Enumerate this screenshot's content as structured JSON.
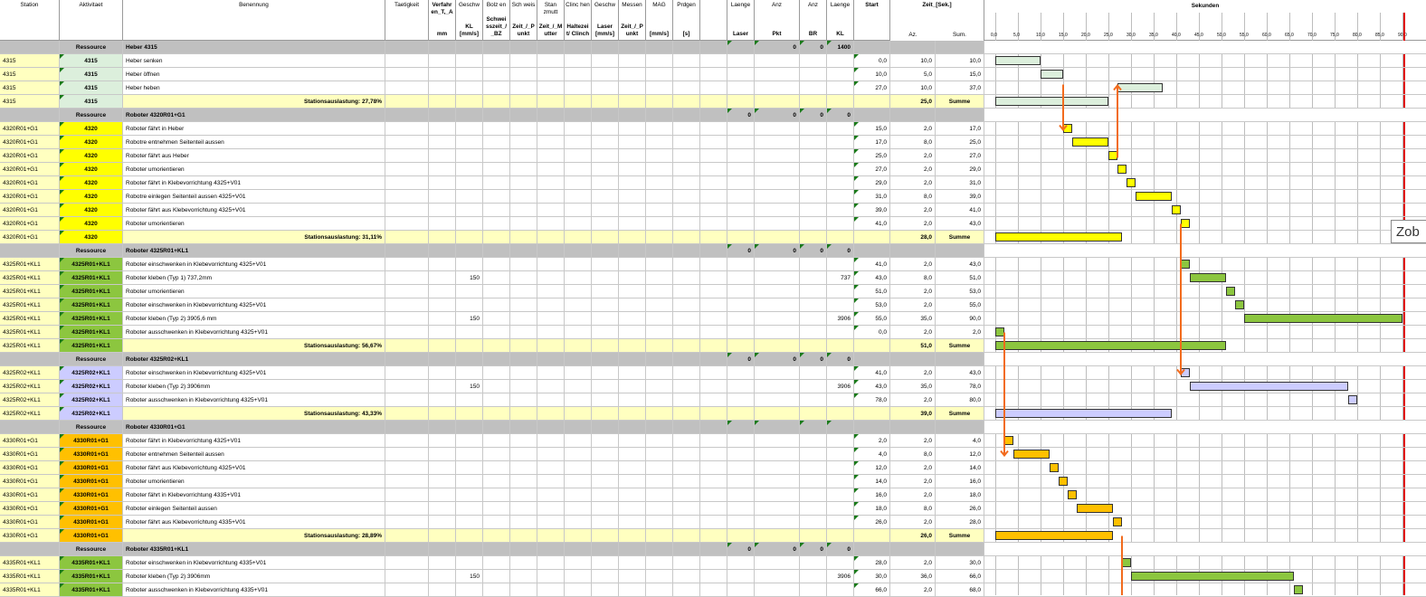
{
  "header": {
    "station": "Station",
    "aktivitaet": "Aktivitaet",
    "benennung": "Benennung",
    "taetigkeit": "Taetigkeit",
    "verfahren_top": "Verfahr en_T,_A",
    "verfahren_bot": "mm",
    "geschw1_top": "Geschw",
    "geschw1_bot": "KL [mm/s]",
    "bolzen_top": "Bolz en",
    "bolzen_bot": "Schwei sszeit_/ _BZ",
    "schweiss_top": "Sch weis",
    "schweiss_bot": "Zeit_/_P unkt",
    "stanz_top": "Stan zmutt",
    "stanz_bot": "Zeit_/_M utter",
    "clinch_top": "Clinc hen",
    "clinch_bot": "Haltezei t/ Clinch",
    "geschw2_top": "Geschw",
    "geschw2_bot": "Laser [mm/s]",
    "messen_top": "Messen",
    "messen_bot": "Zeit_/_P unkt",
    "mag_top": "MAG",
    "mag_bot": "[mm/s]",
    "pruefgen_top": "Prdgen",
    "pruefgen_bot": "[s]",
    "laenge1_top": "Laenge",
    "laenge1_bot": "Laser",
    "anz_pkt_top": "Anz",
    "anz_pkt_bot": "Pkt",
    "anz_br_top": "Anz",
    "anz_br_bot": "BR",
    "laenge2_top": "Laenge",
    "laenge2_bot": "KL",
    "start": "Start",
    "zeit": "Zeit_[Sek.]",
    "az": "Az.",
    "summe": "Sum.",
    "sekunden": "Sekunden"
  },
  "chart_data": {
    "type": "gantt",
    "axis_label": "Sekunden",
    "ticks": [
      "0,0",
      "5,0",
      "10,0",
      "15,0",
      "20,0",
      "25,0",
      "30,0",
      "35,0",
      "40,0",
      "45,0",
      "50,0",
      "55,0",
      "60,0",
      "65,0",
      "70,0",
      "75,0",
      "80,0",
      "85,0",
      "90,0"
    ],
    "xlim": [
      0,
      90
    ],
    "cycle_time_marker": 90
  },
  "rows": [
    {
      "kind": "res",
      "aktivitaet": "Ressource",
      "name": "Heber 4315",
      "laser": "",
      "pkt": "0",
      "br": "0",
      "kl": "1400"
    },
    {
      "kind": "act",
      "station": "4315",
      "akt": "4315",
      "color": "#dcefdc",
      "name": "Heber senken",
      "start": "0,0",
      "az": "10,0",
      "sum": "10,0",
      "bs": 0,
      "bd": 10
    },
    {
      "kind": "act",
      "station": "4315",
      "akt": "4315",
      "color": "#dcefdc",
      "name": "Heber öffnen",
      "start": "10,0",
      "az": "5,0",
      "sum": "15,0",
      "bs": 10,
      "bd": 5
    },
    {
      "kind": "act",
      "station": "4315",
      "akt": "4315",
      "color": "#dcefdc",
      "name": "Heber heben",
      "start": "27,0",
      "az": "10,0",
      "sum": "37,0",
      "bs": 27,
      "bd": 10
    },
    {
      "kind": "sum",
      "station": "4315",
      "akt": "4315",
      "color": "#dcefdc",
      "label": "Stationsauslastung:",
      "pct": "27,78%",
      "az": "25,0",
      "sum": "Summe",
      "bs": 0,
      "bd": 25
    },
    {
      "kind": "res",
      "aktivitaet": "Ressource",
      "name": "Roboter 4320R01+G1",
      "laser": "0",
      "pkt": "0",
      "br": "0",
      "kl": "0"
    },
    {
      "kind": "act",
      "station": "4320R01+G1",
      "akt": "4320",
      "color": "#ffff00",
      "name": "Roboter fährt in Heber",
      "start": "15,0",
      "az": "2,0",
      "sum": "17,0",
      "bs": 15,
      "bd": 2
    },
    {
      "kind": "act",
      "station": "4320R01+G1",
      "akt": "4320",
      "color": "#ffff00",
      "name": "Robotre entnehmen Seitenteil aussen",
      "start": "17,0",
      "az": "8,0",
      "sum": "25,0",
      "bs": 17,
      "bd": 8
    },
    {
      "kind": "act",
      "station": "4320R01+G1",
      "akt": "4320",
      "color": "#ffff00",
      "name": "Roboter fährt aus Heber",
      "start": "25,0",
      "az": "2,0",
      "sum": "27,0",
      "bs": 25,
      "bd": 2
    },
    {
      "kind": "act",
      "station": "4320R01+G1",
      "akt": "4320",
      "color": "#ffff00",
      "name": "Roboter umorientieren",
      "start": "27,0",
      "az": "2,0",
      "sum": "29,0",
      "bs": 27,
      "bd": 2
    },
    {
      "kind": "act",
      "station": "4320R01+G1",
      "akt": "4320",
      "color": "#ffff00",
      "name": "Roboter fährt in Klebevorrichtung 4325+V01",
      "start": "29,0",
      "az": "2,0",
      "sum": "31,0",
      "bs": 29,
      "bd": 2
    },
    {
      "kind": "act",
      "station": "4320R01+G1",
      "akt": "4320",
      "color": "#ffff00",
      "name": "Robotre einlegen Seitenteil aussen 4325+V01",
      "start": "31,0",
      "az": "8,0",
      "sum": "39,0",
      "bs": 31,
      "bd": 8
    },
    {
      "kind": "act",
      "station": "4320R01+G1",
      "akt": "4320",
      "color": "#ffff00",
      "name": "Roboter fährt aus Klebevorrichtung 4325+V01",
      "start": "39,0",
      "az": "2,0",
      "sum": "41,0",
      "bs": 39,
      "bd": 2
    },
    {
      "kind": "act",
      "station": "4320R01+G1",
      "akt": "4320",
      "color": "#ffff00",
      "name": "Roboter umorientieren",
      "start": "41,0",
      "az": "2,0",
      "sum": "43,0",
      "bs": 41,
      "bd": 2
    },
    {
      "kind": "sum",
      "station": "4320R01+G1",
      "akt": "4320",
      "color": "#ffff00",
      "label": "Stationsauslastung:",
      "pct": "31,11%",
      "az": "28,0",
      "sum": "Summe",
      "bs": 0,
      "bd": 28
    },
    {
      "kind": "res",
      "aktivitaet": "Ressource",
      "name": "Roboter 4325R01+KL1",
      "laser": "0",
      "pkt": "0",
      "br": "0",
      "kl": "0"
    },
    {
      "kind": "act",
      "station": "4325R01+KL1",
      "akt": "4325R01+KL1",
      "color": "#8cc63f",
      "name": "Roboter einschwenken in Klebevorrichtung 4325+V01",
      "start": "41,0",
      "az": "2,0",
      "sum": "43,0",
      "bs": 41,
      "bd": 2
    },
    {
      "kind": "act",
      "station": "4325R01+KL1",
      "akt": "4325R01+KL1",
      "color": "#8cc63f",
      "name": "Roboter kleben (Typ 1) 737,2mm",
      "geschw": "150",
      "kl": "737",
      "start": "43,0",
      "az": "8,0",
      "sum": "51,0",
      "bs": 43,
      "bd": 8
    },
    {
      "kind": "act",
      "station": "4325R01+KL1",
      "akt": "4325R01+KL1",
      "color": "#8cc63f",
      "name": "Roboter umorientieren",
      "start": "51,0",
      "az": "2,0",
      "sum": "53,0",
      "bs": 51,
      "bd": 2
    },
    {
      "kind": "act",
      "station": "4325R01+KL1",
      "akt": "4325R01+KL1",
      "color": "#8cc63f",
      "name": "Roboter einschwenken in Klebevorrichtung 4325+V01",
      "start": "53,0",
      "az": "2,0",
      "sum": "55,0",
      "bs": 53,
      "bd": 2
    },
    {
      "kind": "act",
      "station": "4325R01+KL1",
      "akt": "4325R01+KL1",
      "color": "#8cc63f",
      "name": "Roboter kleben (Typ 2) 3905,6 mm",
      "geschw": "150",
      "kl": "3906",
      "start": "55,0",
      "az": "35,0",
      "sum": "90,0",
      "bs": 55,
      "bd": 35
    },
    {
      "kind": "act",
      "station": "4325R01+KL1",
      "akt": "4325R01+KL1",
      "color": "#8cc63f",
      "name": "Roboter ausschwenken in Klebevorrichtung 4325+V01",
      "start": "0,0",
      "az": "2,0",
      "sum": "2,0",
      "bs": 0,
      "bd": 2
    },
    {
      "kind": "sum",
      "station": "4325R01+KL1",
      "akt": "4325R01+KL1",
      "color": "#8cc63f",
      "label": "Stationsauslastung:",
      "pct": "56,67%",
      "az": "51,0",
      "sum": "Summe",
      "bs": 0,
      "bd": 51
    },
    {
      "kind": "res",
      "aktivitaet": "Ressource",
      "name": "Roboter 4325R02+KL1",
      "laser": "0",
      "pkt": "0",
      "br": "0",
      "kl": "0"
    },
    {
      "kind": "act",
      "station": "4325R02+KL1",
      "akt": "4325R02+KL1",
      "color": "#ccccff",
      "name": "Roboter einschwenken in Klebevorrichtung 4325+V01",
      "start": "41,0",
      "az": "2,0",
      "sum": "43,0",
      "bs": 41,
      "bd": 2
    },
    {
      "kind": "act",
      "station": "4325R02+KL1",
      "akt": "4325R02+KL1",
      "color": "#ccccff",
      "name": "Roboter kleben (Typ 2) 3906mm",
      "geschw": "150",
      "kl": "3906",
      "start": "43,0",
      "az": "35,0",
      "sum": "78,0",
      "bs": 43,
      "bd": 35
    },
    {
      "kind": "act",
      "station": "4325R02+KL1",
      "akt": "4325R02+KL1",
      "color": "#ccccff",
      "name": "Roboter ausschwenken in Klebevorrichtung 4325+V01",
      "start": "78,0",
      "az": "2,0",
      "sum": "80,0",
      "bs": 78,
      "bd": 2
    },
    {
      "kind": "sum",
      "station": "4325R02+KL1",
      "akt": "4325R02+KL1",
      "color": "#ccccff",
      "label": "Stationsauslastung:",
      "pct": "43,33%",
      "az": "39,0",
      "sum": "Summe",
      "bs": 0,
      "bd": 39
    },
    {
      "kind": "res",
      "aktivitaet": "Ressource",
      "name": "Roboter 4330R01+G1",
      "laser": "",
      "pkt": "",
      "br": "",
      "kl": ""
    },
    {
      "kind": "act",
      "station": "4330R01+G1",
      "akt": "4330R01+G1",
      "color": "#ffc000",
      "name": "Roboter fährt in Klebevorrichtung 4325+V01",
      "start": "2,0",
      "az": "2,0",
      "sum": "4,0",
      "bs": 2,
      "bd": 2
    },
    {
      "kind": "act",
      "station": "4330R01+G1",
      "akt": "4330R01+G1",
      "color": "#ffc000",
      "name": "Roboter entnehmen Seitenteil aussen",
      "start": "4,0",
      "az": "8,0",
      "sum": "12,0",
      "bs": 4,
      "bd": 8
    },
    {
      "kind": "act",
      "station": "4330R01+G1",
      "akt": "4330R01+G1",
      "color": "#ffc000",
      "name": "Roboter fährt aus Klebevorrichtung 4325+V01",
      "start": "12,0",
      "az": "2,0",
      "sum": "14,0",
      "bs": 12,
      "bd": 2
    },
    {
      "kind": "act",
      "station": "4330R01+G1",
      "akt": "4330R01+G1",
      "color": "#ffc000",
      "name": "Roboter umorientieren",
      "start": "14,0",
      "az": "2,0",
      "sum": "16,0",
      "bs": 14,
      "bd": 2
    },
    {
      "kind": "act",
      "station": "4330R01+G1",
      "akt": "4330R01+G1",
      "color": "#ffc000",
      "name": "Roboter fährt in Klebevorrichtung 4335+V01",
      "start": "16,0",
      "az": "2,0",
      "sum": "18,0",
      "bs": 16,
      "bd": 2
    },
    {
      "kind": "act",
      "station": "4330R01+G1",
      "akt": "4330R01+G1",
      "color": "#ffc000",
      "name": "Roboter einlegen Seitenteil aussen",
      "start": "18,0",
      "az": "8,0",
      "sum": "26,0",
      "bs": 18,
      "bd": 8
    },
    {
      "kind": "act",
      "station": "4330R01+G1",
      "akt": "4330R01+G1",
      "color": "#ffc000",
      "name": "Roboter fährt aus Klebevorrichtung 4335+V01",
      "start": "26,0",
      "az": "2,0",
      "sum": "28,0",
      "bs": 26,
      "bd": 2
    },
    {
      "kind": "sum",
      "station": "4330R01+G1",
      "akt": "4330R01+G1",
      "color": "#ffc000",
      "label": "Stationsauslastung:",
      "pct": "28,89%",
      "az": "26,0",
      "sum": "Summe",
      "bs": 0,
      "bd": 26
    },
    {
      "kind": "res",
      "aktivitaet": "Ressource",
      "name": "Roboter 4335R01+KL1",
      "laser": "0",
      "pkt": "0",
      "br": "0",
      "kl": "0"
    },
    {
      "kind": "act",
      "station": "4335R01+KL1",
      "akt": "4335R01+KL1",
      "color": "#8cc63f",
      "name": "Roboter einschwenken in Klebevorrichtung 4335+V01",
      "start": "28,0",
      "az": "2,0",
      "sum": "30,0",
      "bs": 28,
      "bd": 2
    },
    {
      "kind": "act",
      "station": "4335R01+KL1",
      "akt": "4335R01+KL1",
      "color": "#8cc63f",
      "name": "Roboter kleben (Typ 2) 3906mm",
      "geschw": "150",
      "kl": "3906",
      "start": "30,0",
      "az": "36,0",
      "sum": "66,0",
      "bs": 30,
      "bd": 36
    },
    {
      "kind": "act",
      "station": "4335R01+KL1",
      "akt": "4335R01+KL1",
      "color": "#8cc63f",
      "name": "Roboter ausschwenken in Klebevorrichtung 4335+V01",
      "start": "66,0",
      "az": "2,0",
      "sum": "68,0",
      "bs": 66,
      "bd": 2
    }
  ],
  "tooltip": "Zob"
}
